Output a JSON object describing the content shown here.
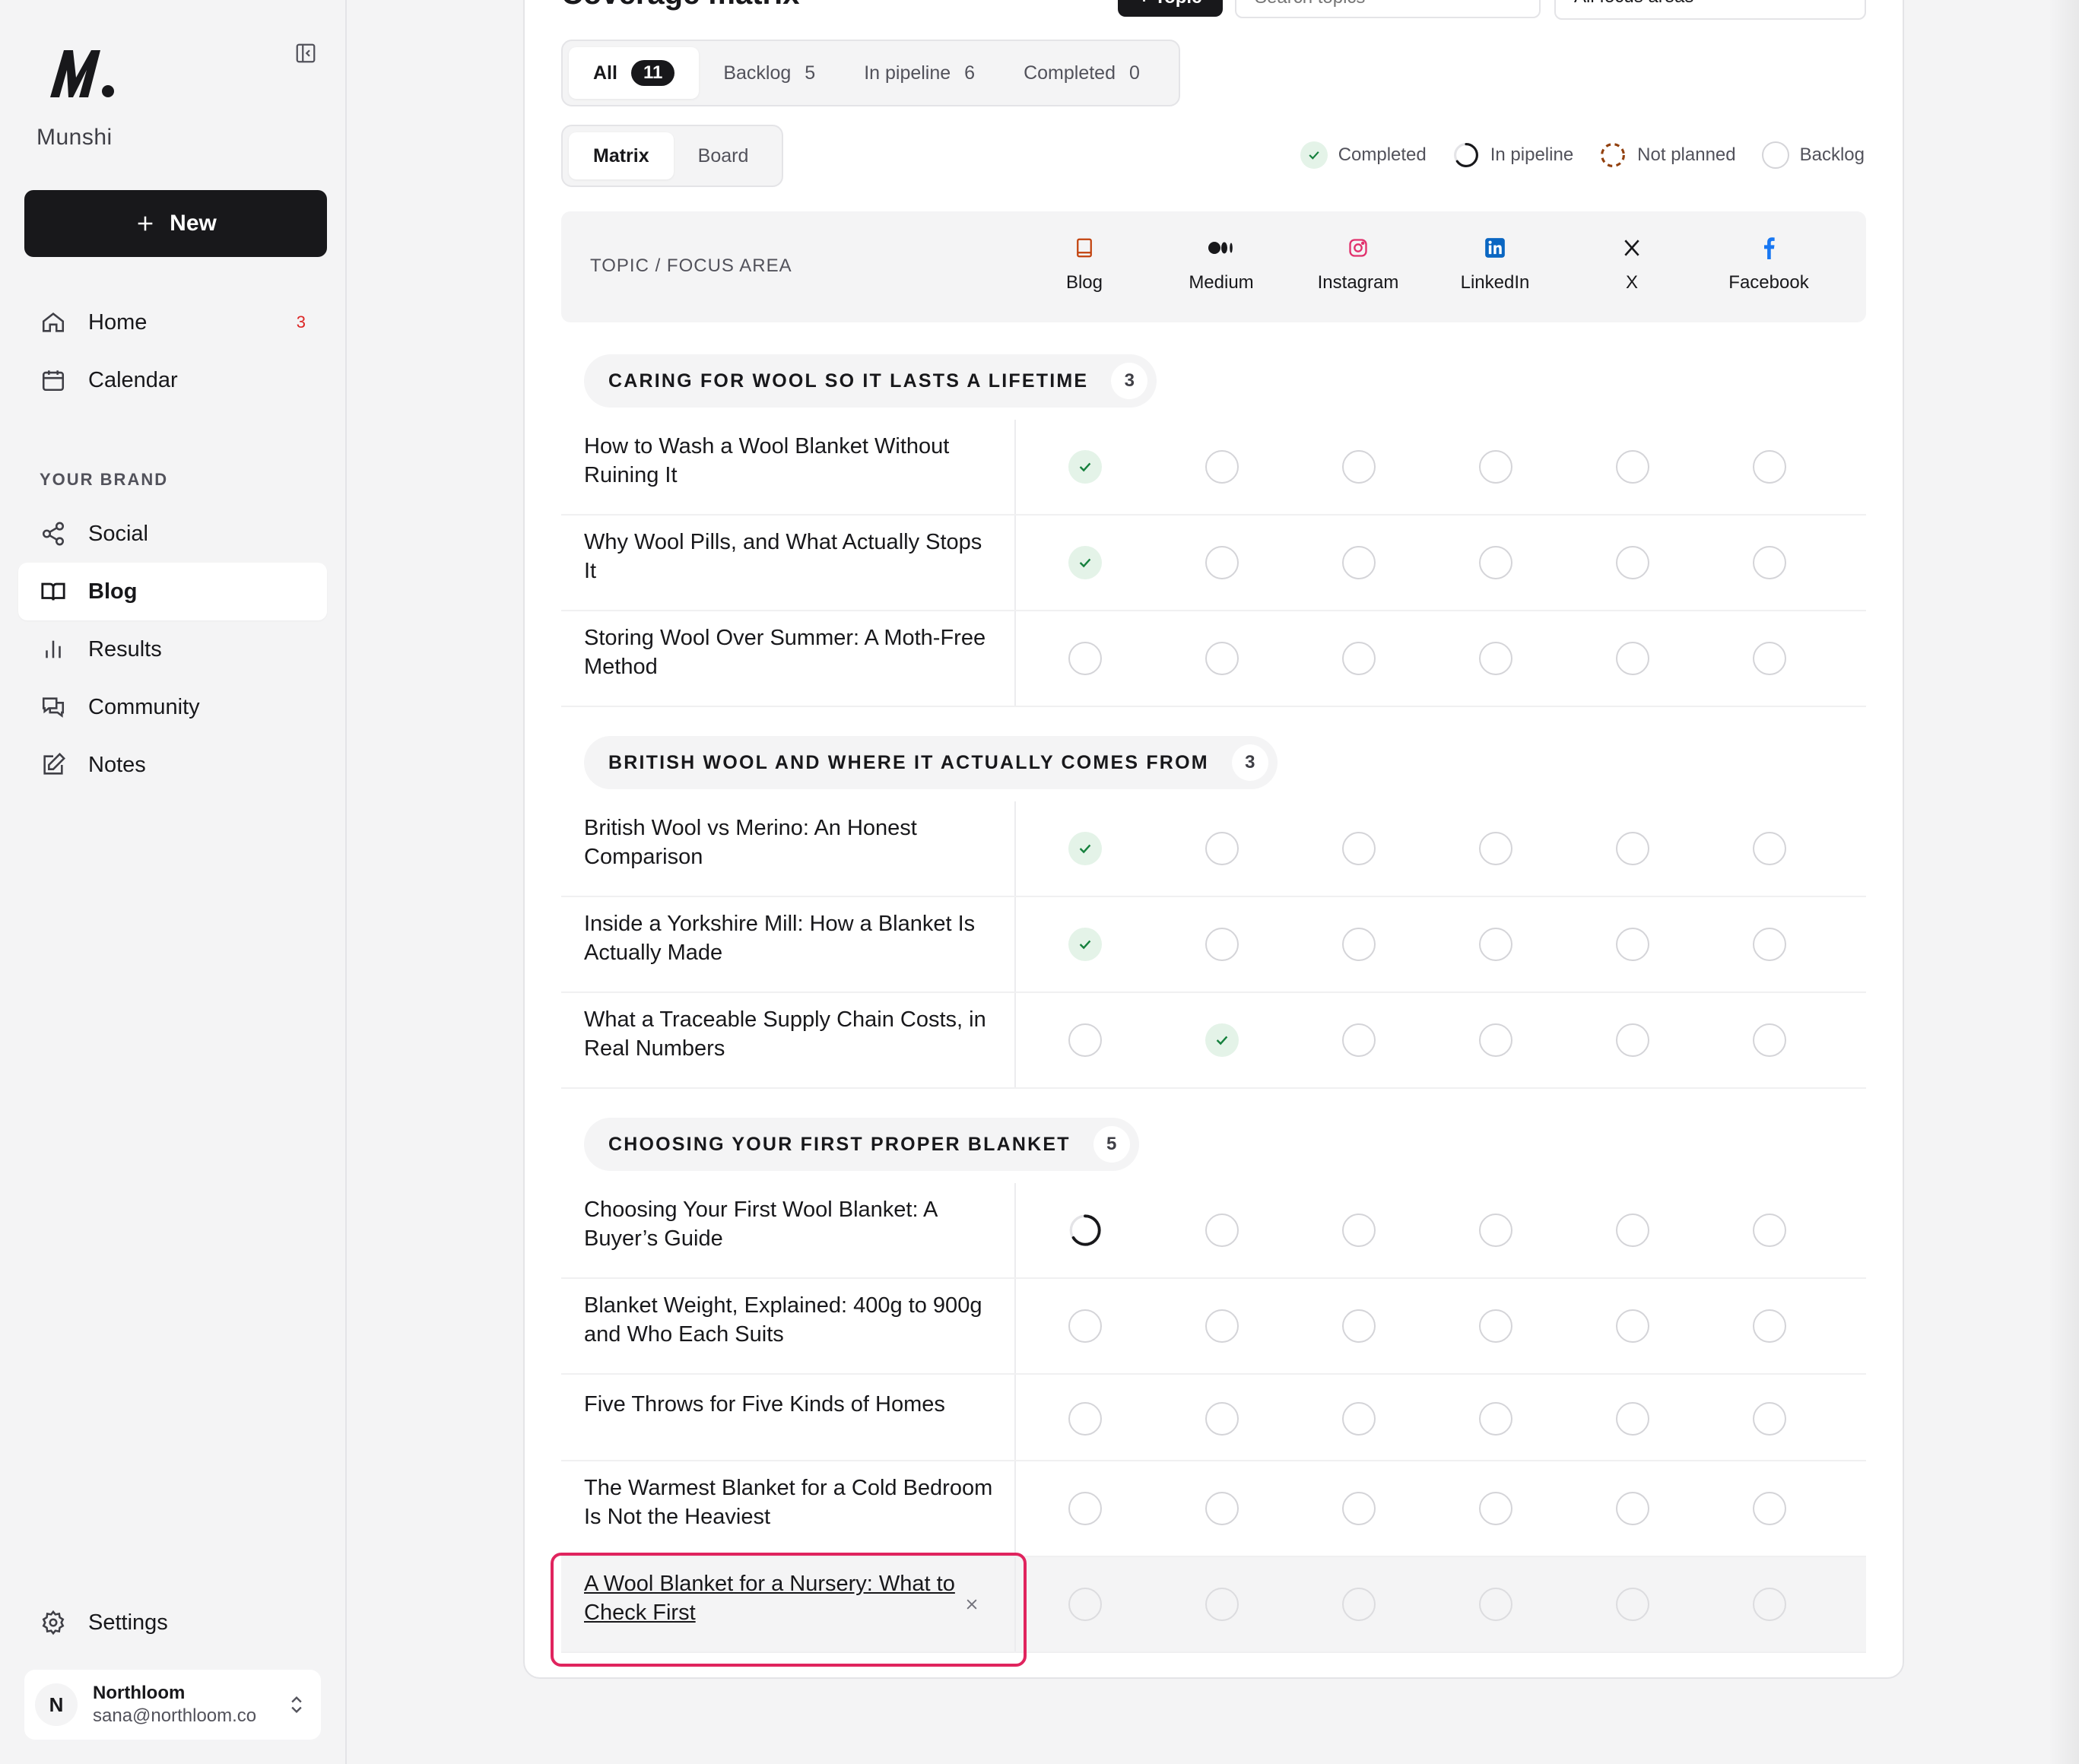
{
  "app": {
    "brand_name": "Munshi",
    "new_label": "New"
  },
  "sidebar": {
    "nav_items": [
      {
        "label": "Home",
        "badge": "3",
        "icon": "home-icon"
      },
      {
        "label": "Calendar",
        "icon": "calendar-icon"
      }
    ],
    "section_label": "YOUR BRAND",
    "brand_items": [
      {
        "label": "Social",
        "icon": "share-icon"
      },
      {
        "label": "Blog",
        "icon": "book-icon",
        "active": true
      },
      {
        "label": "Results",
        "icon": "bar-chart-icon"
      },
      {
        "label": "Community",
        "icon": "chat-icon"
      },
      {
        "label": "Notes",
        "icon": "edit-icon"
      }
    ],
    "settings_label": "Settings",
    "account": {
      "initial": "N",
      "name": "Northloom",
      "email": "sana@northloom.co"
    }
  },
  "header": {
    "title": "Coverage matrix",
    "add_topic_label": "+ Topic",
    "search_placeholder": "Search topics",
    "area_select_value": "All focus areas"
  },
  "filters": {
    "tabs": [
      {
        "label": "All",
        "count": "11",
        "active": true
      },
      {
        "label": "Backlog",
        "count": "5"
      },
      {
        "label": "In pipeline",
        "count": "6"
      },
      {
        "label": "Completed",
        "count": "0"
      }
    ]
  },
  "views": {
    "tabs": [
      {
        "label": "Matrix",
        "active": true
      },
      {
        "label": "Board"
      }
    ]
  },
  "legend": [
    {
      "label": "Completed",
      "status": "completed"
    },
    {
      "label": "In pipeline",
      "status": "pipeline"
    },
    {
      "label": "Not planned",
      "status": "not-planned"
    },
    {
      "label": "Backlog",
      "status": "backlog"
    }
  ],
  "matrix": {
    "head_label": "TOPIC / FOCUS AREA",
    "columns": [
      {
        "label": "Blog",
        "icon": "book-icon",
        "color": "#c2410c"
      },
      {
        "label": "Medium",
        "icon": "medium-icon",
        "color": "#18181b"
      },
      {
        "label": "Instagram",
        "icon": "instagram-icon",
        "color": "#e1306c"
      },
      {
        "label": "LinkedIn",
        "icon": "linkedin-icon",
        "color": "#0a66c2"
      },
      {
        "label": "X",
        "icon": "x-icon",
        "color": "#18181b"
      },
      {
        "label": "Facebook",
        "icon": "facebook-icon",
        "color": "#1877f2"
      }
    ],
    "groups": [
      {
        "title": "CARING FOR WOOL SO IT LASTS A LIFETIME",
        "count": "3",
        "rows": [
          {
            "title": "How to Wash a Wool Blanket Without Ruining It",
            "cells": [
              "completed",
              "backlog",
              "backlog",
              "backlog",
              "backlog",
              "backlog"
            ]
          },
          {
            "title": "Why Wool Pills, and What Actually Stops It",
            "cells": [
              "completed",
              "backlog",
              "backlog",
              "backlog",
              "backlog",
              "backlog"
            ]
          },
          {
            "title": "Storing Wool Over Summer: A Moth-Free Method",
            "cells": [
              "backlog",
              "backlog",
              "backlog",
              "backlog",
              "backlog",
              "backlog"
            ]
          }
        ]
      },
      {
        "title": "BRITISH WOOL AND WHERE IT ACTUALLY COMES FROM",
        "count": "3",
        "rows": [
          {
            "title": "British Wool vs Merino: An Honest Comparison",
            "cells": [
              "completed",
              "backlog",
              "backlog",
              "backlog",
              "backlog",
              "backlog"
            ]
          },
          {
            "title": "Inside a Yorkshire Mill: How a Blanket Is Actually Made",
            "cells": [
              "completed",
              "backlog",
              "backlog",
              "backlog",
              "backlog",
              "backlog"
            ]
          },
          {
            "title": "What a Traceable Supply Chain Costs, in Real Numbers",
            "cells": [
              "backlog",
              "completed",
              "backlog",
              "backlog",
              "backlog",
              "backlog"
            ]
          }
        ]
      },
      {
        "title": "CHOOSING YOUR FIRST PROPER BLANKET",
        "count": "5",
        "rows": [
          {
            "title": "Choosing Your First Wool Blanket: A Buyer’s Guide",
            "cells": [
              "pipeline",
              "backlog",
              "backlog",
              "backlog",
              "backlog",
              "backlog"
            ]
          },
          {
            "title": "Blanket Weight, Explained: 400g to 900g and Who Each Suits",
            "cells": [
              "backlog",
              "backlog",
              "backlog",
              "backlog",
              "backlog",
              "backlog"
            ]
          },
          {
            "title": "Five Throws for Five Kinds of Homes",
            "cells": [
              "backlog",
              "backlog",
              "backlog",
              "backlog",
              "backlog",
              "backlog"
            ]
          },
          {
            "title": "The Warmest Blanket for a Cold Bedroom Is Not the Heaviest",
            "cells": [
              "backlog",
              "backlog",
              "backlog",
              "backlog",
              "backlog",
              "backlog"
            ]
          },
          {
            "title": "A Wool Blanket for a Nursery: What to Check First",
            "cells": [
              "backlog",
              "backlog",
              "backlog",
              "backlog",
              "backlog",
              "backlog"
            ],
            "selected": true
          }
        ]
      }
    ]
  },
  "colors": {
    "accent": "#18181b",
    "completed_bg": "#e4f3e8",
    "completed_check": "#15803d",
    "not_planned": "#92400e",
    "selection": "#e0245e"
  }
}
